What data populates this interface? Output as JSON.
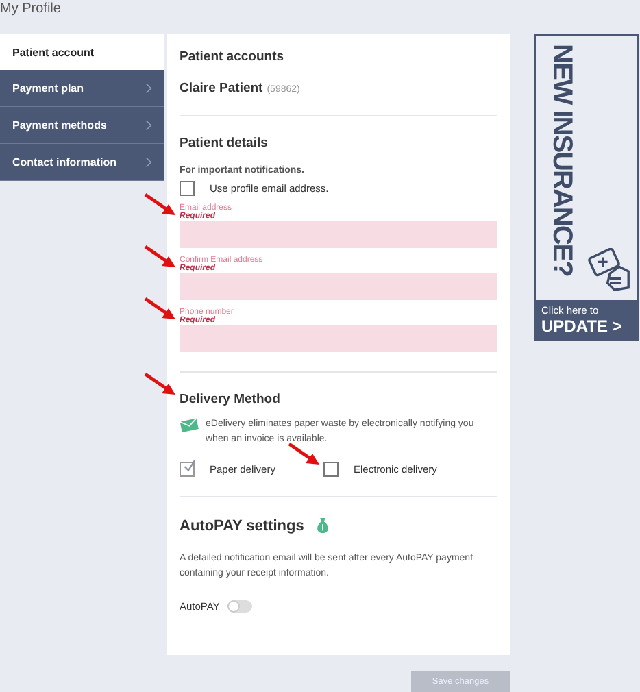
{
  "page_title": "My Profile",
  "sidebar": {
    "items": [
      {
        "label": "Patient account",
        "selected": true,
        "chevron": false
      },
      {
        "label": "Payment plan",
        "selected": false,
        "chevron": true
      },
      {
        "label": "Payment methods",
        "selected": false,
        "chevron": true
      },
      {
        "label": "Contact information",
        "selected": false,
        "chevron": true
      }
    ]
  },
  "patient_accounts": {
    "heading": "Patient accounts",
    "name": "Claire Patient",
    "account_number": "(59862)"
  },
  "patient_details": {
    "heading": "Patient details",
    "note": "For important notifications.",
    "use_profile_email": {
      "label": "Use profile email address.",
      "checked": false
    },
    "fields": [
      {
        "label": "Email address",
        "error": "Required",
        "arrow": true
      },
      {
        "label": "Confirm Email address",
        "error": "Required",
        "arrow": true
      },
      {
        "label": "Phone number",
        "error": "Required",
        "arrow": true
      }
    ]
  },
  "delivery": {
    "heading": "Delivery Method",
    "arrow": true,
    "description": "eDelivery eliminates paper waste by electronically notifying you when an invoice is available.",
    "options": [
      {
        "label": "Paper delivery",
        "checked": true,
        "arrow": false
      },
      {
        "label": "Electronic delivery",
        "checked": false,
        "arrow": true
      }
    ]
  },
  "autopay": {
    "heading": "AutoPAY settings",
    "description": "A detailed notification email will be sent after every AutoPAY payment containing your receipt information.",
    "toggle_label": "AutoPAY",
    "on": false
  },
  "save_button": {
    "label": "Save changes",
    "disabled": true
  },
  "banner": {
    "headline": "NEW INSURANCE?",
    "line_1": "Click here to",
    "line_2": "UPDATE >"
  }
}
